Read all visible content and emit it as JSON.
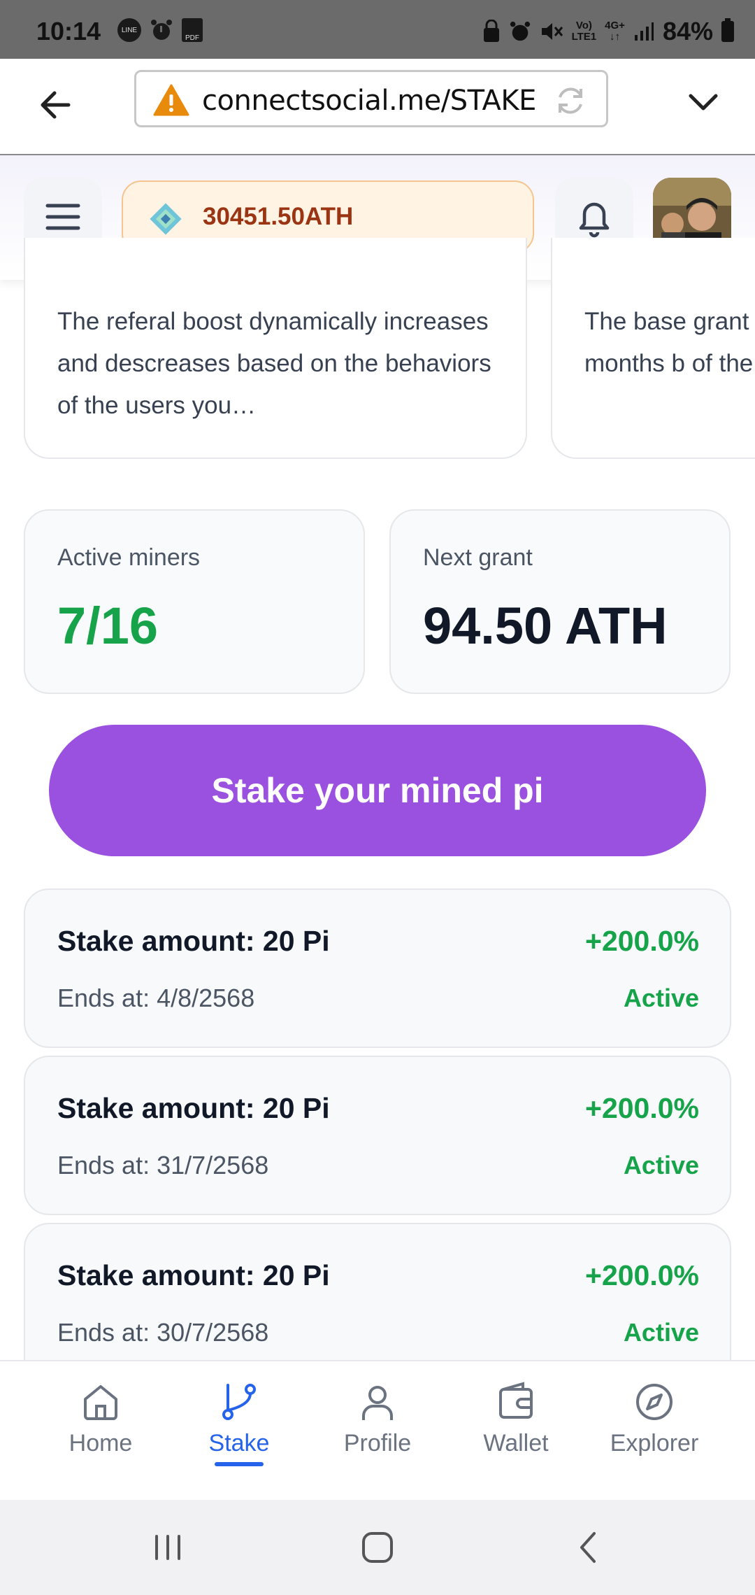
{
  "status_bar": {
    "time": "10:14",
    "left_icons": [
      "line-icon",
      "alarm-icon",
      "pdf-icon"
    ],
    "right_icons": [
      "lock-icon",
      "alarm-icon",
      "mute-icon",
      "volte-icon",
      "4g-icon",
      "signal-icon",
      "battery-icon"
    ],
    "network_label_top": "Vo)",
    "network_label_bottom": "LTE1",
    "data_label": "4G+",
    "battery": "84%"
  },
  "browser": {
    "url": "connectsocial.me/STAKE",
    "security_icon": "warning-icon"
  },
  "header": {
    "balance": "30451.50ATH",
    "token_icon": "diamond-token-icon"
  },
  "info_cards": [
    {
      "text": "The referal boost dynamically increases and descreases based on the behaviors of the users you…"
    },
    {
      "text": "The base grant each months b of the network"
    }
  ],
  "stats": {
    "active_miners_label": "Active miners",
    "active_miners_value": "7/16",
    "next_grant_label": "Next grant",
    "next_grant_value": "94.50 ATH"
  },
  "stake_button_label": "Stake your mined pi",
  "stakes": [
    {
      "amount": "Stake amount: 20 Pi",
      "percent": "+200.0%",
      "ends": "Ends at: 4/8/2568",
      "status": "Active"
    },
    {
      "amount": "Stake amount: 20 Pi",
      "percent": "+200.0%",
      "ends": "Ends at: 31/7/2568",
      "status": "Active"
    },
    {
      "amount": "Stake amount: 20 Pi",
      "percent": "+200.0%",
      "ends": "Ends at: 30/7/2568",
      "status": "Active"
    }
  ],
  "nav": [
    {
      "label": "Home",
      "icon": "home-icon",
      "active": false
    },
    {
      "label": "Stake",
      "icon": "stake-branch-icon",
      "active": true
    },
    {
      "label": "Profile",
      "icon": "profile-icon",
      "active": false
    },
    {
      "label": "Wallet",
      "icon": "wallet-icon",
      "active": false
    },
    {
      "label": "Explorer",
      "icon": "compass-icon",
      "active": false
    }
  ],
  "colors": {
    "accent_purple": "#9b51e0",
    "positive_green": "#16a34a",
    "active_nav_blue": "#2563eb",
    "balance_text": "#9a3412",
    "balance_bg": "#fff3e4"
  }
}
